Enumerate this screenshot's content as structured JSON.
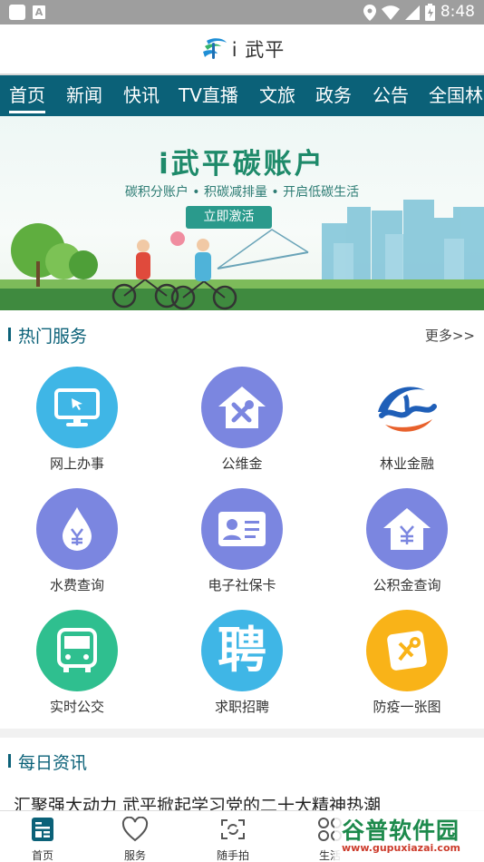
{
  "status_bar": {
    "time": "8:48",
    "notification_letter": "A"
  },
  "header": {
    "title": "i 武平"
  },
  "tabs": [
    {
      "label": "首页",
      "active": true
    },
    {
      "label": "新闻"
    },
    {
      "label": "快讯"
    },
    {
      "label": "TV直播"
    },
    {
      "label": "文旅"
    },
    {
      "label": "政务"
    },
    {
      "label": "公告"
    },
    {
      "label": "全国林"
    }
  ],
  "banner": {
    "title": "i武平碳账户",
    "subtitle": "碳积分账户 • 积碳减排量 • 开启低碳生活",
    "button_label": "立即激活"
  },
  "hot_services": {
    "title": "热门服务",
    "more_label": "更多>>",
    "items": [
      {
        "label": "网上办事",
        "icon": "monitor-icon",
        "color": "#3fb6e6"
      },
      {
        "label": "公维金",
        "icon": "house-tools-icon",
        "color": "#7b86e0"
      },
      {
        "label": "林业金融",
        "icon": "forestry-finance-logo-icon",
        "color": "#ffffff"
      },
      {
        "label": "水费查询",
        "icon": "water-drop-yuan-icon",
        "color": "#7b86e0"
      },
      {
        "label": "电子社保卡",
        "icon": "id-card-icon",
        "color": "#7b86e0"
      },
      {
        "label": "公积金查询",
        "icon": "house-yuan-icon",
        "color": "#7b86e0"
      },
      {
        "label": "实时公交",
        "icon": "bus-icon",
        "color": "#2fbf8f"
      },
      {
        "label": "求职招聘",
        "icon": "recruit-character-icon",
        "color": "#3fb6e6",
        "glyph": "聘"
      },
      {
        "label": "防疫一张图",
        "icon": "map-pin-icon",
        "color": "#f9b318"
      }
    ]
  },
  "daily_news": {
    "title": "每日资讯",
    "headline_peek": "汇聚强大动力 武平掀起学习党的二十大精神热潮"
  },
  "bottom_nav": [
    {
      "label": "首页",
      "icon": "home-news-icon",
      "active": true
    },
    {
      "label": "服务",
      "icon": "heart-icon"
    },
    {
      "label": "随手拍",
      "icon": "snapshot-icon"
    },
    {
      "label": "生活",
      "icon": "grid-icon"
    }
  ],
  "watermark": {
    "text": "谷普软件园",
    "url": "www.gupuxiazai.com"
  },
  "colors": {
    "brand": "#0b6178",
    "accent_green": "#1e8a6a"
  }
}
